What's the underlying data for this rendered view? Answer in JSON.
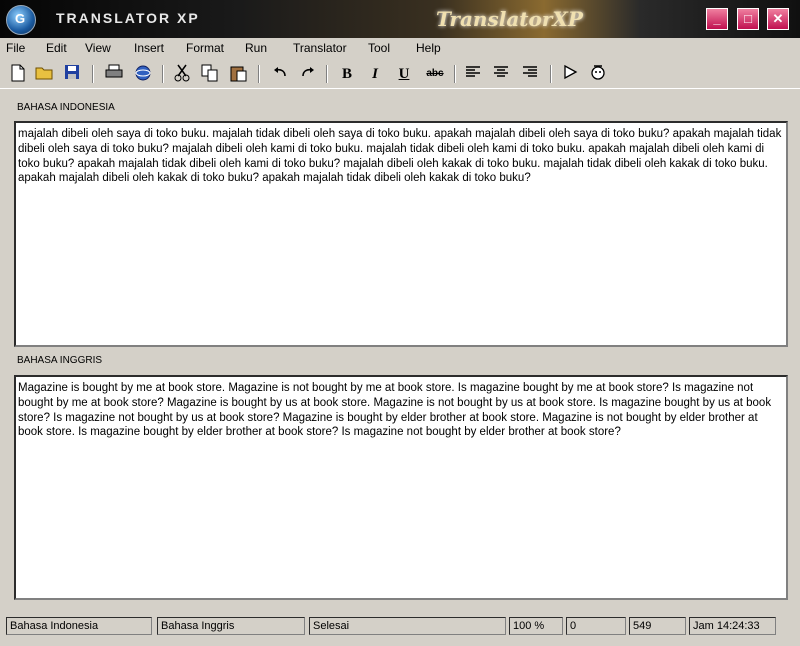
{
  "window": {
    "title": "TRANSLATOR XP",
    "brand": "TranslatorXP",
    "logo_letter": "G",
    "minimize_glyph": "_",
    "maximize_glyph": "□",
    "close_glyph": "✕"
  },
  "menu": {
    "items": [
      "File",
      "Edit",
      "View",
      "Insert",
      "Format",
      "Run",
      "Translator",
      "Tool",
      "Help"
    ]
  },
  "toolbar": {
    "buttons": [
      "new-icon",
      "open-folder-icon",
      "save-icon",
      "print-icon",
      "globe-icon",
      "cut-icon",
      "copy-icon",
      "paste-icon",
      "undo-icon",
      "redo-icon",
      "bold-icon",
      "italic-icon",
      "underline-icon",
      "strikethrough-icon",
      "align-left-icon",
      "align-center-icon",
      "align-right-icon",
      "run-icon",
      "translate-icon"
    ],
    "bold": "B",
    "italic": "I",
    "underline": "U",
    "strike": "abc"
  },
  "source": {
    "label": "BAHASA INDONESIA",
    "text": "majalah dibeli oleh saya di toko buku. majalah tidak dibeli oleh saya di toko buku. apakah majalah dibeli oleh saya di toko buku? apakah majalah tidak dibeli oleh saya di toko buku? majalah dibeli oleh kami di toko buku. majalah tidak dibeli oleh kami di toko buku. apakah majalah dibeli oleh kami di toko buku? apakah majalah tidak dibeli oleh kami di toko buku? majalah dibeli oleh kakak di toko buku. majalah tidak dibeli oleh kakak di toko buku. apakah majalah dibeli oleh kakak di toko buku? apakah majalah tidak dibeli oleh kakak di toko buku?"
  },
  "target": {
    "label": "BAHASA INGGRIS",
    "text": "Magazine is bought by me at book store. Magazine is not bought by me at book store. Is magazine bought by me at book store? Is magazine not bought by me at book store? Magazine is bought by us at book store. Magazine is not bought by us at book store. Is magazine bought by us at book store? Is magazine not bought by us at book store? Magazine is bought by elder brother at book store. Magazine is not bought by elder brother at book store. Is magazine bought by elder brother at book store? Is magazine not bought by elder brother at book store?"
  },
  "status": {
    "source_lang": "Bahasa Indonesia",
    "target_lang": "Bahasa Inggris",
    "state": "Selesai",
    "zoom": "100 %",
    "pos": "0",
    "count": "549",
    "clock": "Jam 14:24:33"
  },
  "colors": {
    "window_bg": "#d4d0c8",
    "titlebar": "#101010",
    "window_buttons": "#e0407a",
    "textbox_bg": "#ffffff"
  }
}
